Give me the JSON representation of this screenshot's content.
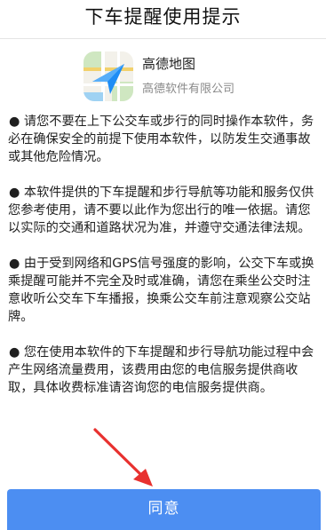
{
  "dialog": {
    "title": "下车提醒使用提示"
  },
  "app": {
    "name": "高德地图",
    "company": "高德软件有限公司",
    "logo_icon": "amap-logo-icon",
    "accent": "#1e8df5"
  },
  "notices": [
    "● 请您不要在上下公交车或步行的同时操作本软件，务必在确保安全的前提下使用本软件，以防发生交通事故或其他危险情况。",
    "● 本软件提供的下车提醒和步行导航等功能和服务仅供您参考使用，请不要以此作为您出行的唯一依据。请您以实际的交通和道路状况为准，并遵守交通法律法规。",
    "● 由于受到网络和GPS信号强度的影响，公交下车或换乘提醒可能并不完全及时或准确，请您在乘坐公交时注意收听公交车下车播报，换乘公交车前注意观察公交站牌。",
    "● 您在使用本软件的下车提醒和步行导航功能过程中会产生网络流量费用，该费用由您的电信服务提供商收取，具体收费标准请咨询您的电信服务提供商。"
  ],
  "agree_button": {
    "label": "同意",
    "color": "#4c8ef2"
  },
  "annotation": {
    "arrow_icon": "red-pointer-arrow-icon",
    "color": "#e8312f"
  }
}
